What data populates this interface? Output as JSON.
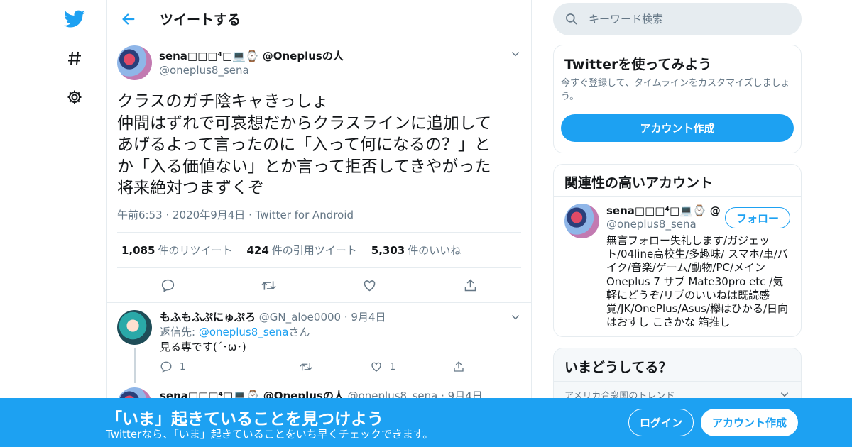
{
  "colors": {
    "accent": "#1da1f2",
    "text": "#14171a",
    "muted": "#657786",
    "border": "#e6ecf0"
  },
  "nav": {
    "icons": [
      "twitter-logo-icon",
      "hashtag-icon",
      "gear-icon"
    ]
  },
  "header": {
    "title": "ツイートする"
  },
  "tweet": {
    "author_name": "sena□□□⁴□💻⌚ @Oneplusの人",
    "author_handle": "@oneplus8_sena",
    "text": "クラスのガチ陰キャきっしょ\n仲間はずれで可哀想だからクラスラインに追加して\nあげるよって言ったのに「入って何になるの？」と\nか「入る価値ない」とか言って拒否してきやがった\n将来絶対つまずくぞ",
    "time": "午前6:53",
    "date": "2020年9月4日",
    "source": "Twitter for Android",
    "retweets": "1,085",
    "retweets_label": "件のリツイート",
    "quotes": "424",
    "quotes_label": "件の引用ツイート",
    "likes": "5,303",
    "likes_label": "件のいいね"
  },
  "reply": {
    "name": "もふもふぷにゅぷろ",
    "handle": "@GN_aloe0000",
    "date": "9月4日",
    "reply_to_prefix": "返信先: ",
    "reply_to_handle": "@oneplus8_sena",
    "reply_to_suffix": "さん",
    "text": "見る専です(´･ω･)",
    "reply_count": "1",
    "like_count": "1"
  },
  "next_tweet": {
    "name": "sena□□□⁴□💻⌚ @Oneplusの人",
    "handle": "@oneplus8_sena",
    "date": "9月4日"
  },
  "search": {
    "placeholder": "キーワード検索"
  },
  "signup_card": {
    "title": "Twitterを使ってみよう",
    "desc": "今すぐ登録して、タイムラインをカスタマイズしましょう。",
    "button": "アカウント作成"
  },
  "related_card": {
    "title": "関連性の高いアカウント",
    "name": "sena□□□⁴□💻⌚ @...",
    "handle": "@oneplus8_sena",
    "follow_button": "フォロー",
    "bio": "無言フォロー失礼します/ガジェット/04line高校生/多趣味/ スマホ/車/バイク/音楽/ゲーム/動物/PC/メイン Oneplus 7 サブ Mate30pro etc /気軽にどうぞ/リプのいいねは既読感覚/JK/OnePlus/Asus/欅はひかる/日向はおすし こさかな 箱推し"
  },
  "trends_card": {
    "title": "いまどうしてる？",
    "subtitle": "アメリカ合衆国のトレンド"
  },
  "banner": {
    "title": "「いま」起きていることを見つけよう",
    "subtitle": "Twitterなら、「いま」起きていることをいち早くチェックできます。",
    "login": "ログイン",
    "signup": "アカウント作成"
  }
}
